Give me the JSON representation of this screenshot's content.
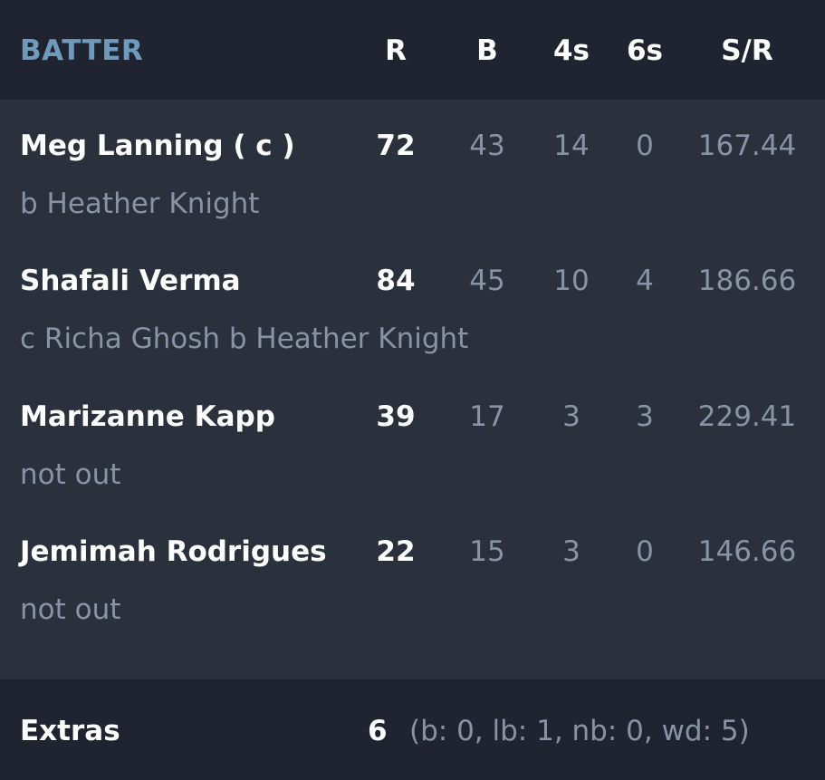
{
  "header": {
    "batter": "BATTER",
    "r": "R",
    "b": "B",
    "fours": "4s",
    "sixes": "6s",
    "sr": "S/R"
  },
  "batters": [
    {
      "name": "Meg Lanning ( c )",
      "dismissal": "b Heather Knight",
      "r": "72",
      "b": "43",
      "fours": "14",
      "sixes": "0",
      "sr": "167.44"
    },
    {
      "name": "Shafali Verma",
      "dismissal": "c Richa Ghosh b Heather Knight",
      "r": "84",
      "b": "45",
      "fours": "10",
      "sixes": "4",
      "sr": "186.66"
    },
    {
      "name": "Marizanne Kapp",
      "dismissal": "not out",
      "r": "39",
      "b": "17",
      "fours": "3",
      "sixes": "3",
      "sr": "229.41"
    },
    {
      "name": "Jemimah Rodrigues",
      "dismissal": "not out",
      "r": "22",
      "b": "15",
      "fours": "3",
      "sixes": "0",
      "sr": "146.66"
    }
  ],
  "extras": {
    "label": "Extras",
    "total": "6",
    "detail": "(b: 0, lb: 1, nb: 0, wd: 5)"
  },
  "colors": {
    "header_bg": "#1f2430",
    "body_bg": "#2a303c",
    "accent": "#6e9bbc",
    "muted": "#8893a5",
    "text": "#ffffff"
  }
}
